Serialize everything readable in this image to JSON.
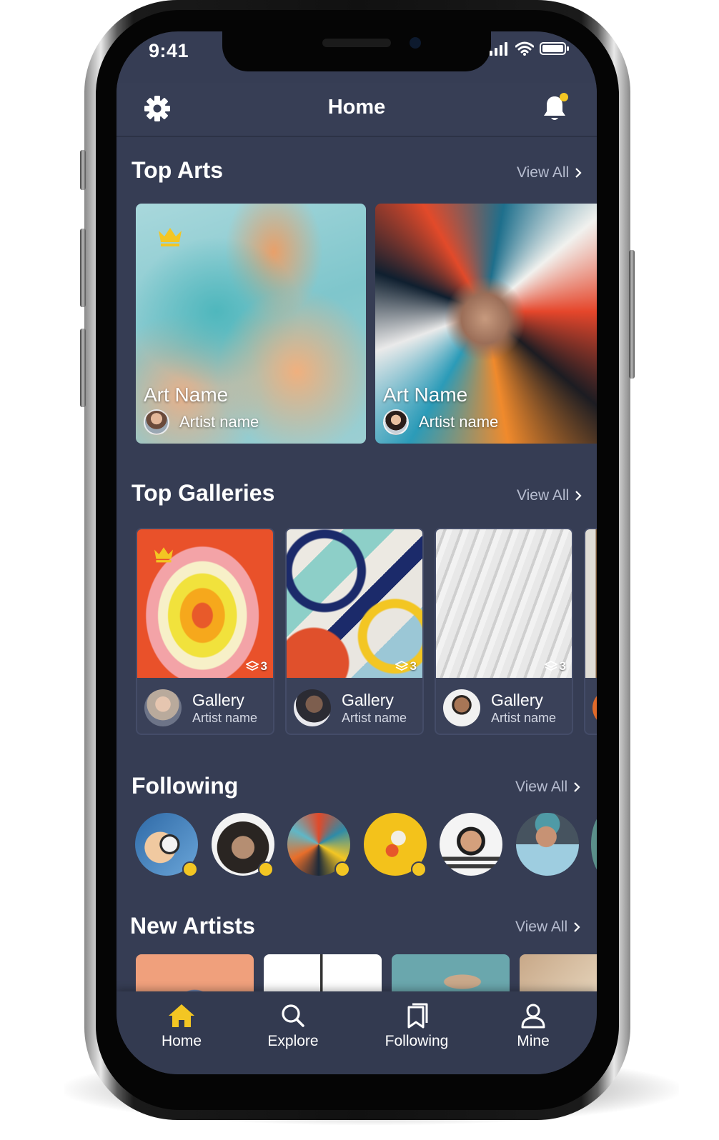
{
  "status_bar": {
    "time": "9:41"
  },
  "header": {
    "title": "Home",
    "settings_icon": "gear-icon",
    "notification_icon": "bell-icon"
  },
  "top_arts": {
    "title": "Top Arts",
    "view_all": "View All",
    "items": [
      {
        "name": "Art Name",
        "artist": "Artist name"
      },
      {
        "name": "Art Name",
        "artist": "Artist name"
      }
    ]
  },
  "top_galleries": {
    "title": "Top Galleries",
    "view_all": "View All",
    "items": [
      {
        "name": "Gallery",
        "artist": "Artist name",
        "count": "3"
      },
      {
        "name": "Gallery",
        "artist": "Artist name",
        "count": "3"
      },
      {
        "name": "Gallery",
        "artist": "Artist name",
        "count": "3"
      }
    ]
  },
  "following": {
    "title": "Following",
    "view_all": "View All"
  },
  "new_artists": {
    "title": "New Artists",
    "view_all": "View All"
  },
  "tabs": [
    {
      "label": "Home",
      "icon": "home-icon"
    },
    {
      "label": "Explore",
      "icon": "search-icon"
    },
    {
      "label": "Following",
      "icon": "bookmark-icon"
    },
    {
      "label": "Mine",
      "icon": "user-icon"
    }
  ],
  "colors": {
    "background": "#363d54",
    "accent": "#f3c623",
    "text": "#ffffff",
    "muted": "#b7bdd0"
  }
}
